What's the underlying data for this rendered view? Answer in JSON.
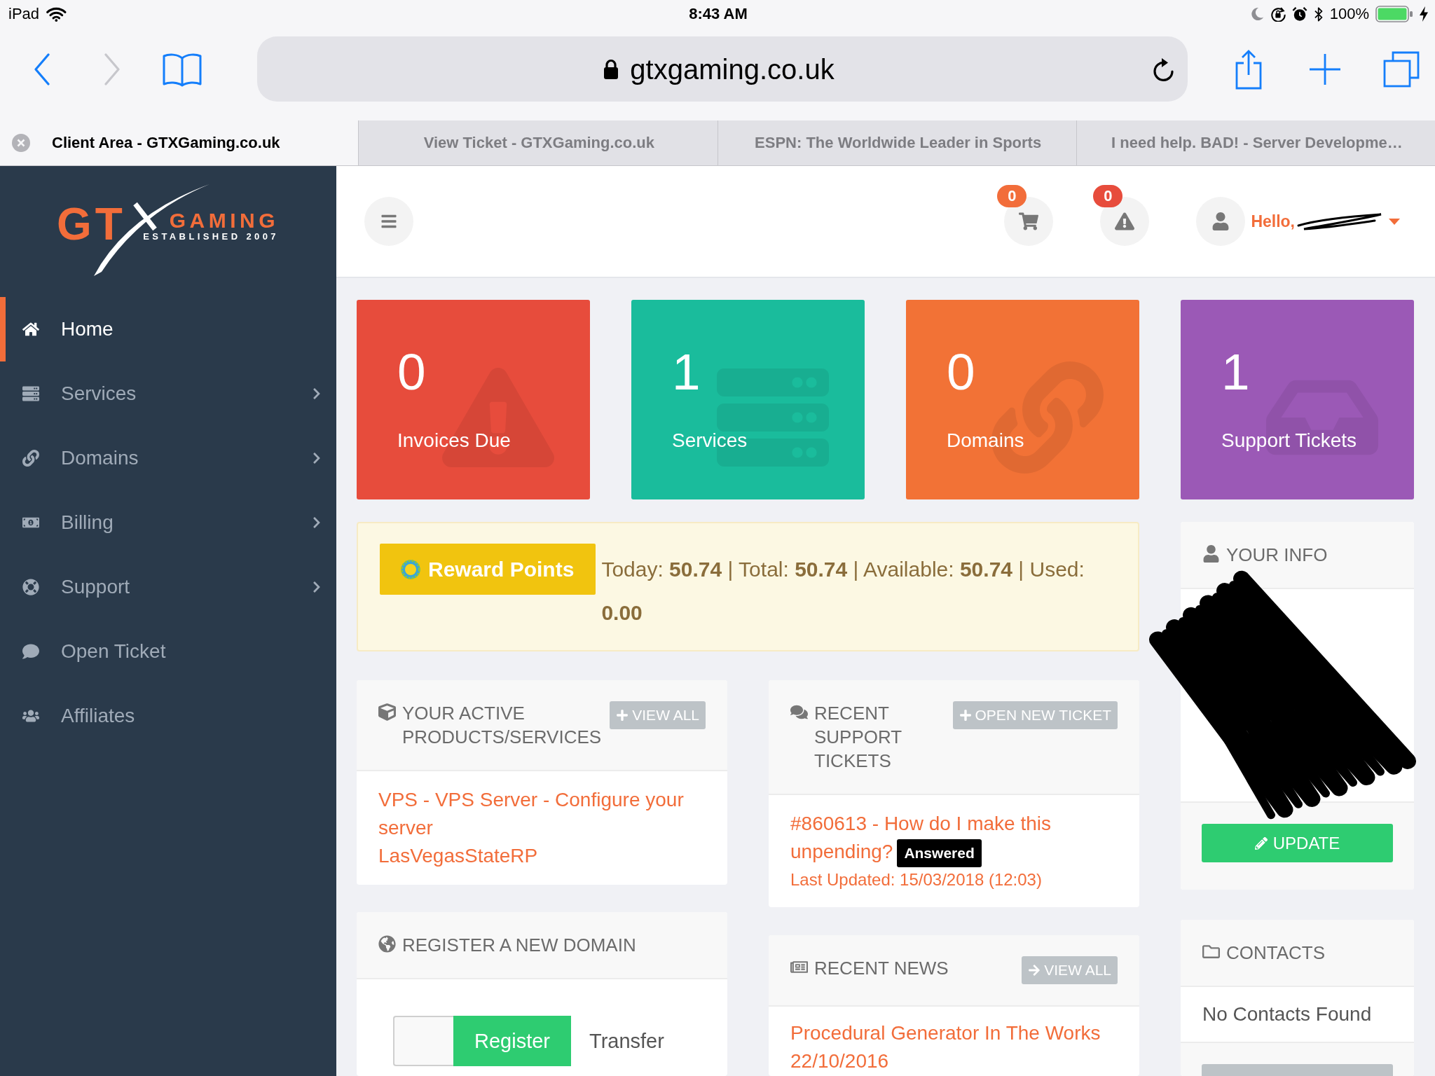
{
  "status_bar": {
    "device": "iPad",
    "time": "8:43 AM",
    "battery": "100%"
  },
  "browser": {
    "nav_buttons": [
      {
        "kind": "back",
        "disabled": false
      },
      {
        "kind": "forward",
        "disabled": true
      },
      {
        "kind": "bookmarks",
        "disabled": false
      }
    ],
    "url": "gtxgaming.co.uk",
    "actions": [
      {
        "kind": "share"
      },
      {
        "kind": "new_tab"
      },
      {
        "kind": "tabs"
      }
    ]
  },
  "tabs": [
    {
      "label": "Client Area - GTXGaming.co.uk",
      "selected": true
    },
    {
      "label": "View Ticket - GTXGaming.co.uk",
      "selected": false
    },
    {
      "label": "ESPN: The Worldwide Leader in Sports",
      "selected": false
    },
    {
      "label": "I need help. BAD! - Server Developme…",
      "selected": false
    }
  ],
  "sidebar": {
    "logo": {
      "mark": "GT",
      "word": "GAMING",
      "tagline": "ESTABLISHED 2007"
    },
    "items": [
      {
        "kind": "home",
        "label": "Home",
        "selected": true,
        "submenu": false
      },
      {
        "kind": "services",
        "label": "Services",
        "selected": false,
        "submenu": true
      },
      {
        "kind": "domains",
        "label": "Domains",
        "selected": false,
        "submenu": true
      },
      {
        "kind": "billing",
        "label": "Billing",
        "selected": false,
        "submenu": true
      },
      {
        "kind": "support",
        "label": "Support",
        "selected": false,
        "submenu": true
      },
      {
        "kind": "ticket",
        "label": "Open Ticket",
        "selected": false,
        "submenu": false
      },
      {
        "kind": "affiliates",
        "label": "Affiliates",
        "selected": false,
        "submenu": false
      }
    ]
  },
  "header": {
    "actions": [
      {
        "kind": "cart",
        "badge": "0",
        "color": "#f26d3a"
      },
      {
        "kind": "alert",
        "badge": "0",
        "color": "#e74c3c"
      }
    ],
    "greeting": "Hello,"
  },
  "stats": [
    {
      "kind": "invoices",
      "value": "0",
      "label": "Invoices Due",
      "color": "#e74c3c"
    },
    {
      "kind": "services",
      "value": "1",
      "label": "Services",
      "color": "#1abc9c"
    },
    {
      "kind": "domains",
      "value": "0",
      "label": "Domains",
      "color": "#f27236"
    },
    {
      "kind": "tickets",
      "value": "1",
      "label": "Support Tickets",
      "color": "#9b59b6"
    }
  ],
  "rewards": {
    "button": "Reward Points",
    "summary": "Today: **50.74** | Total: **50.74** | Available: **50.74** | Used: **0.00**"
  },
  "products_panel": {
    "title": "YOUR ACTIVE PRODUCTS/SERVICES",
    "button": "VIEW ALL",
    "items": [
      {
        "name": "VPS - VPS Server - Configure your server",
        "domain": "LasVegasStateRP"
      }
    ]
  },
  "tickets_panel": {
    "title": "RECENT SUPPORT TICKETS",
    "button": "OPEN NEW TICKET",
    "items": [
      {
        "subject": "#860613 - How do I make this unpending?",
        "status": "Answered",
        "updated": "Last Updated: 15/03/2018 (12:03)"
      }
    ]
  },
  "domain_panel": {
    "title": "REGISTER A NEW DOMAIN",
    "options": [
      {
        "label": "Register",
        "selected": true
      },
      {
        "label": "Transfer",
        "selected": false
      }
    ]
  },
  "news_panel": {
    "title": "RECENT NEWS",
    "button": "VIEW ALL",
    "items": [
      {
        "title": "Procedural Generator In The Works",
        "date": "22/10/2016"
      }
    ]
  },
  "info_panel": {
    "title": "YOUR INFO",
    "button": "UPDATE"
  },
  "contacts_panel": {
    "title": "CONTACTS",
    "message": "No Contacts Found"
  }
}
